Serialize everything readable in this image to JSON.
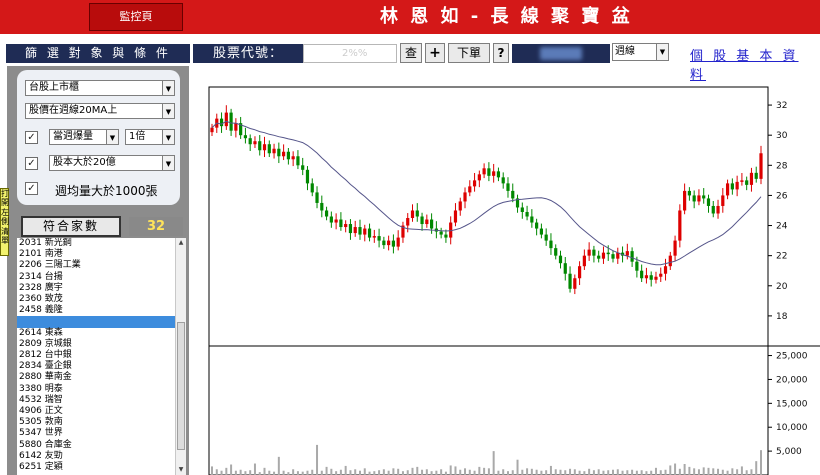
{
  "header": {
    "monitor_label": "監控頁",
    "title": "林 恩 如 - 長 線 聚 寶 盆"
  },
  "toolbar": {
    "filter_title": "篩 選 對 象 與 條 件",
    "code_label": "股票代號：",
    "code_value": "2%%",
    "query_label": "查",
    "plus_label": "+",
    "order_label": "下單",
    "help_label": "?",
    "period_value": "週線",
    "profile_link": "個 股 基 本 資 料"
  },
  "filters": {
    "market": "台股上市櫃",
    "price_condition": "股價在週線20MA上",
    "volume_type": "當週爆量",
    "volume_multiple": "1倍",
    "capital": "股本大於20億",
    "weekly_volume": "週均量大於1000張",
    "check_mark": "✓"
  },
  "results": {
    "match_label": "符合家數",
    "match_count": "32",
    "side_tab": "打開左側清單"
  },
  "stock_list": [
    "2031 新光鋼",
    "2101 南港",
    "2206 三陽工業",
    "2314 台揚",
    "2328 廣宇",
    "2360 致茂",
    "2458 義隆",
    "",
    "2614 東森",
    "2809 京城銀",
    "2812 台中銀",
    "2834 臺企銀",
    "2880 華南金",
    "3380 明泰",
    "4532 瑞智",
    "4906 正文",
    "5305 敦南",
    "5347 世界",
    "5880 合庫金",
    "6142 友勁",
    "6251 定穎"
  ],
  "chart_data": {
    "type": "candlestick",
    "price_axis": {
      "ticks": [
        18,
        20,
        22,
        24,
        26,
        28,
        30,
        32
      ],
      "range": [
        16.2,
        33.2
      ]
    },
    "volume_axis": {
      "ticks": [
        "5,000",
        "10,000",
        "15,000",
        "20,000",
        "25,000"
      ],
      "range": [
        0,
        27000
      ]
    },
    "colors": {
      "up": "#dd0000",
      "down": "#008800",
      "ma": "#55558a",
      "volume": "#a9a9a9"
    },
    "closes": [
      30.5,
      31.1,
      30.6,
      31.5,
      30.3,
      30.8,
      30.0,
      29.8,
      29.4,
      29.6,
      29.0,
      29.4,
      28.8,
      29.1,
      28.6,
      28.9,
      28.4,
      28.6,
      28.0,
      27.7,
      26.8,
      26.2,
      25.5,
      25.0,
      24.6,
      24.2,
      24.4,
      23.9,
      24.1,
      23.5,
      23.9,
      23.4,
      23.8,
      23.2,
      23.3,
      23.0,
      22.7,
      23.0,
      22.6,
      23.2,
      24.0,
      24.5,
      25.0,
      24.6,
      24.1,
      24.4,
      23.8,
      23.6,
      23.4,
      23.2,
      24.2,
      25.0,
      25.6,
      26.2,
      26.6,
      27.0,
      27.4,
      27.8,
      27.3,
      27.6,
      27.2,
      26.8,
      26.3,
      25.8,
      25.2,
      24.9,
      24.6,
      24.2,
      23.8,
      23.4,
      23.0,
      22.5,
      22.0,
      21.5,
      20.8,
      19.8,
      20.5,
      21.3,
      22.0,
      22.4,
      22.0,
      21.8,
      22.2,
      22.1,
      21.8,
      22.2,
      22.0,
      22.3,
      21.6,
      21.0,
      20.5,
      20.7,
      20.4,
      20.6,
      20.8,
      21.3,
      22.0,
      23.0,
      25.0,
      26.3,
      26.0,
      25.6,
      26.0,
      25.8,
      25.3,
      24.8,
      25.3,
      26.0,
      26.8,
      26.4,
      26.9,
      27.0,
      26.7,
      27.5,
      27.1,
      28.8
    ],
    "volumes": [
      1800,
      1200,
      900,
      1500,
      2200,
      900,
      1100,
      800,
      1000,
      2400,
      600,
      1500,
      900,
      700,
      3800,
      900,
      600,
      1200,
      800,
      700,
      900,
      1100,
      6300,
      900,
      1700,
      1300,
      800,
      1100,
      1900,
      1000,
      1200,
      900,
      1400,
      700,
      800,
      1000,
      1200,
      900,
      1400,
      1300,
      800,
      1000,
      1500,
      1700,
      1100,
      1200,
      800,
      900,
      1200,
      700,
      2000,
      1800,
      1100,
      1400,
      1100,
      900,
      1700,
      1500,
      1400,
      5000,
      900,
      1200,
      800,
      1000,
      3200,
      1100,
      1400,
      1300,
      1100,
      900,
      1000,
      1900,
      1200,
      1100,
      1000,
      1300,
      1200,
      900,
      800,
      1300,
      1000,
      1200,
      900,
      1000,
      1100,
      1200,
      900,
      1000,
      1100,
      900,
      1000,
      800,
      900,
      1500,
      1000,
      1100,
      2000,
      2400,
      1300,
      2300,
      1700,
      1400,
      1200,
      1600,
      1500,
      1400,
      1300,
      1100,
      900,
      1400,
      1200,
      1800,
      1000,
      1200,
      2900,
      5200
    ]
  }
}
